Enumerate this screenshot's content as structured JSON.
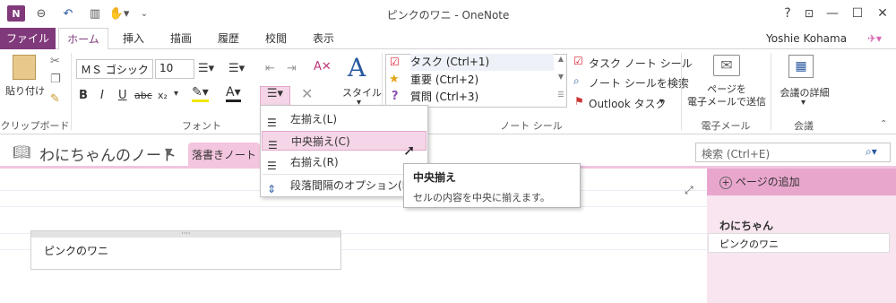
{
  "window": {
    "title": "ピンクのワニ - OneNote",
    "controls": {
      "help": "?",
      "restore": "⊡",
      "minimize": "—",
      "maximize": "☐",
      "close": "✕"
    }
  },
  "tabs": [
    "ファイル",
    "ホーム",
    "挿入",
    "描画",
    "履歴",
    "校閲",
    "表示"
  ],
  "user": {
    "name": "Yoshie Kohama"
  },
  "ribbon": {
    "clipboard": {
      "paste": "貼り付け",
      "label": "クリップボード"
    },
    "font": {
      "name": "ＭＳ ゴシック",
      "size": "10",
      "label": "フォント",
      "bold": "B",
      "italic": "I",
      "underline": "U",
      "strike": "abc",
      "sub": "x₂"
    },
    "styles": {
      "label": "スタイル"
    },
    "tags": {
      "items": [
        "タスク (Ctrl+1)",
        "重要 (Ctrl+2)",
        "質問 (Ctrl+3)"
      ],
      "task_tag": "タスク ノート シール",
      "find_tags": "ノート シールを検索",
      "outlook": "Outlook タスク",
      "label": "ノート シール"
    },
    "email": {
      "button": "ページを\n電子メールで送信",
      "label": "電子メール"
    },
    "meetings": {
      "button": "会議の詳細",
      "label": "会議"
    }
  },
  "notebook": {
    "name": "わにちゃんのノート",
    "section": "落書きノート"
  },
  "search": {
    "placeholder": "検索 (Ctrl+E)"
  },
  "pages": {
    "add": "ページの追加",
    "header": "わにちゃん",
    "items": [
      "ピンクのワニ"
    ]
  },
  "note": {
    "text": "ピンクのワニ"
  },
  "align_menu": {
    "items": [
      "左揃え(L)",
      "中央揃え(C)",
      "右揃え(R)",
      "段落間隔のオプション(P)..."
    ],
    "hovered": "中央揃え(C)"
  },
  "tooltip": {
    "title": "中央揃え",
    "body": "セルの内容を中央に揃えます。"
  },
  "colors": {
    "accent": "#80397b",
    "section": "#f3c5de",
    "pane": "#f8e5f0",
    "addpage": "#e9a6cd",
    "hover": "#f4d6e8"
  }
}
